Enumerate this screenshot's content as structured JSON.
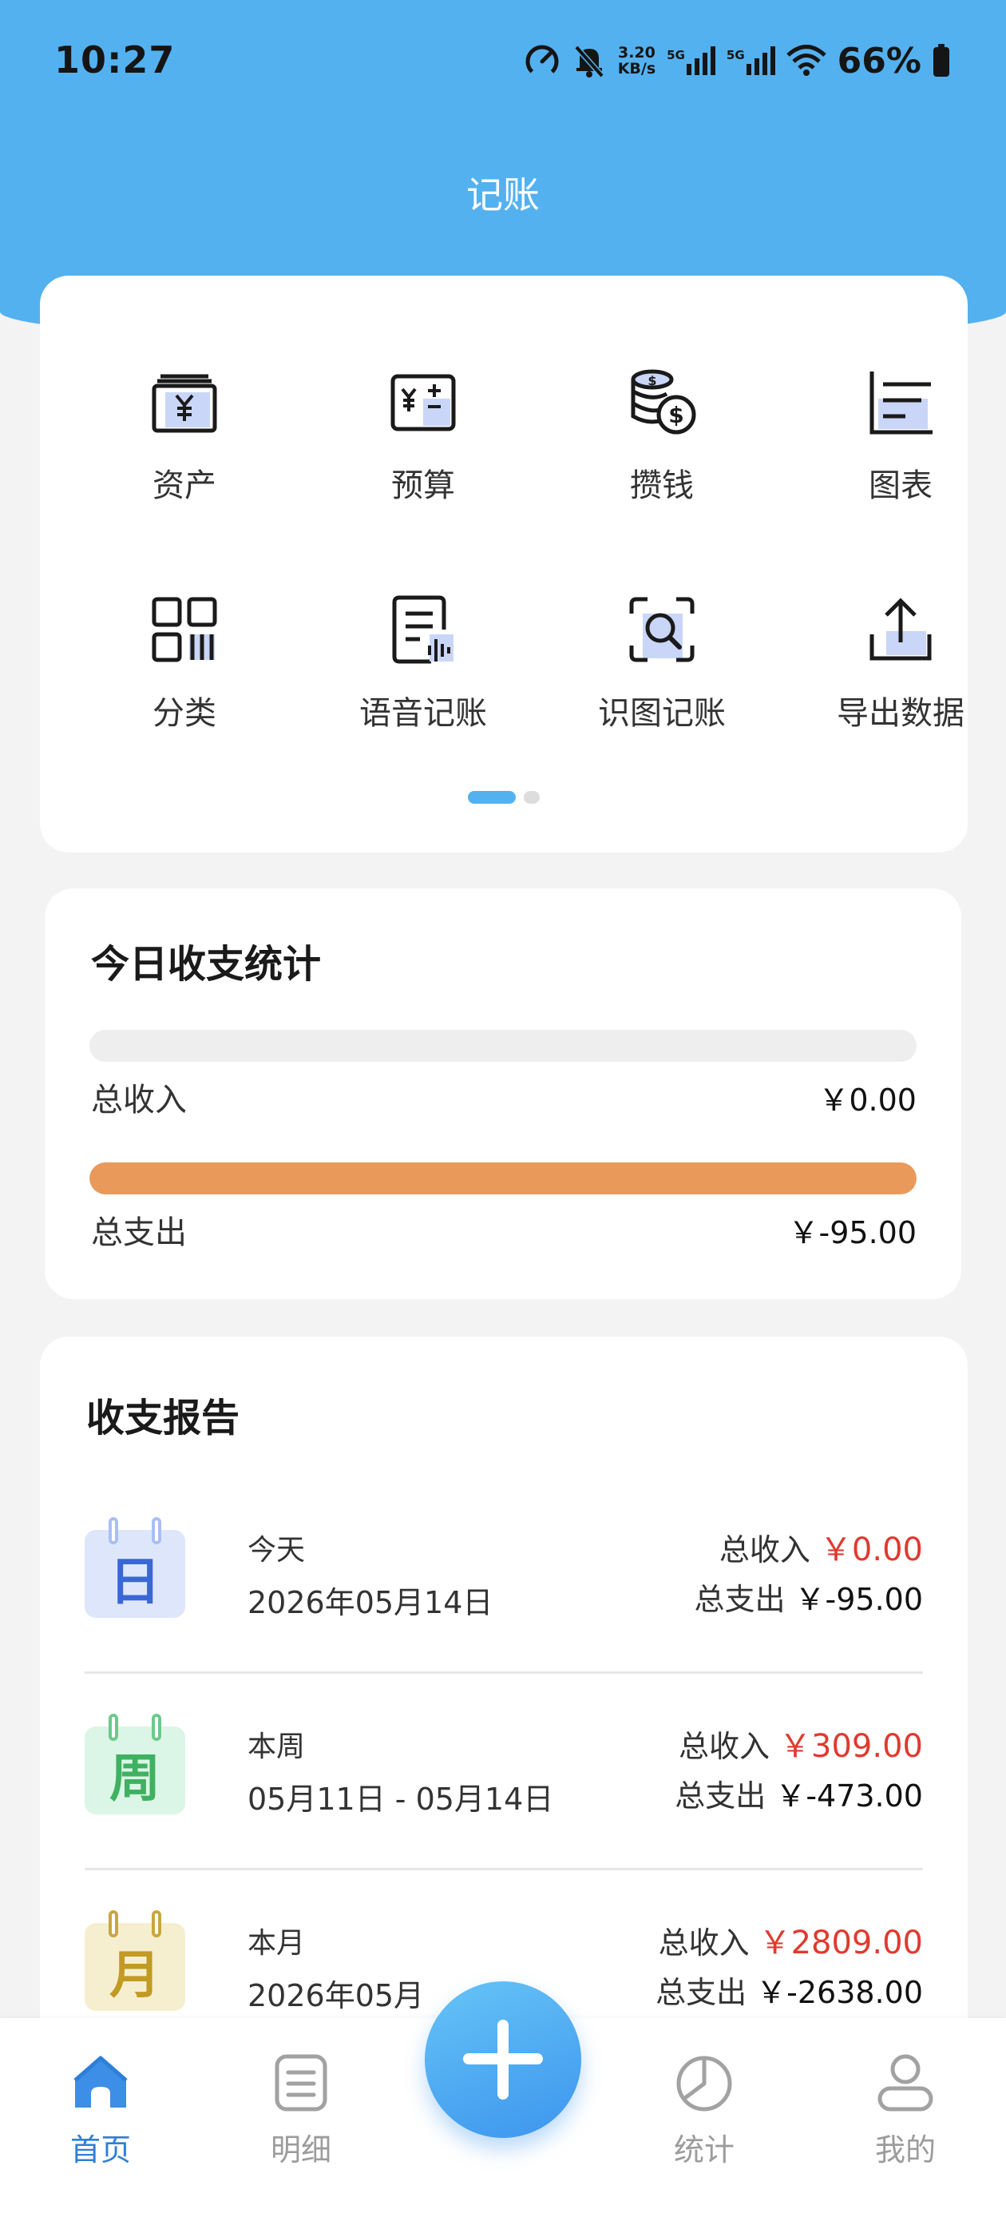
{
  "status_bar": {
    "time": "10:27",
    "net_speed_value": "3.20",
    "net_speed_unit": "KB/s",
    "signal_label_1": "5G",
    "signal_label_2": "5G",
    "battery_percent": "66%"
  },
  "header": {
    "title": "记账"
  },
  "quick_actions": [
    {
      "label": "资产",
      "icon": "wallet-yuan-icon"
    },
    {
      "label": "预算",
      "icon": "budget-calculator-icon"
    },
    {
      "label": "攒钱",
      "icon": "coins-savings-icon"
    },
    {
      "label": "图表",
      "icon": "bar-chart-icon"
    },
    {
      "label": "分类",
      "icon": "category-grid-icon"
    },
    {
      "label": "语音记账",
      "icon": "voice-note-icon"
    },
    {
      "label": "识图记账",
      "icon": "scan-image-icon"
    },
    {
      "label": "导出数据",
      "icon": "export-upload-icon"
    }
  ],
  "pager": {
    "current": 1,
    "total": 2
  },
  "today_stats": {
    "title": "今日收支统计",
    "income_label": "总收入",
    "income_value": "￥0.00",
    "income_fill": 0,
    "expense_label": "总支出",
    "expense_value": "￥-95.00",
    "expense_fill": 1.0,
    "colors": {
      "expense_bar": "#e99a5b",
      "track": "#eeeeee"
    }
  },
  "report": {
    "title": "收支报告",
    "rows": [
      {
        "icon_char": "日",
        "period": "今天",
        "date": "2026年05月14日",
        "income_label": "总收入",
        "income_value": "￥0.00",
        "expense_label": "总支出",
        "expense_value": "￥-95.00",
        "colors": {
          "bg": "#dde6fb",
          "ring": "#a9bff3",
          "char": "#3a67d6"
        }
      },
      {
        "icon_char": "周",
        "period": "本周",
        "date": "05月11日 - 05月14日",
        "income_label": "总收入",
        "income_value": "￥309.00",
        "expense_label": "总支出",
        "expense_value": "￥-473.00",
        "colors": {
          "bg": "#dbf5e6",
          "ring": "#6cc98b",
          "char": "#3fb160"
        }
      },
      {
        "icon_char": "月",
        "period": "本月",
        "date": "2026年05月",
        "income_label": "总收入",
        "income_value": "￥2809.00",
        "expense_label": "总支出",
        "expense_value": "￥-2638.00",
        "colors": {
          "bg": "#f6efcf",
          "ring": "#c9a63e",
          "char": "#c29a24"
        }
      }
    ]
  },
  "bottom_nav": {
    "items": [
      {
        "label": "首页",
        "icon": "home-icon",
        "active": true
      },
      {
        "label": "明细",
        "icon": "list-icon",
        "active": false
      },
      {
        "label": "统计",
        "icon": "pie-chart-icon",
        "active": false
      },
      {
        "label": "我的",
        "icon": "user-icon",
        "active": false
      }
    ],
    "fab_icon": "plus-icon"
  },
  "colors": {
    "header_blue": "#54b1ef",
    "active_nav": "#2e7fd8",
    "income_red": "#e03a2f",
    "icon_light_fill": "#c9d6f7"
  }
}
